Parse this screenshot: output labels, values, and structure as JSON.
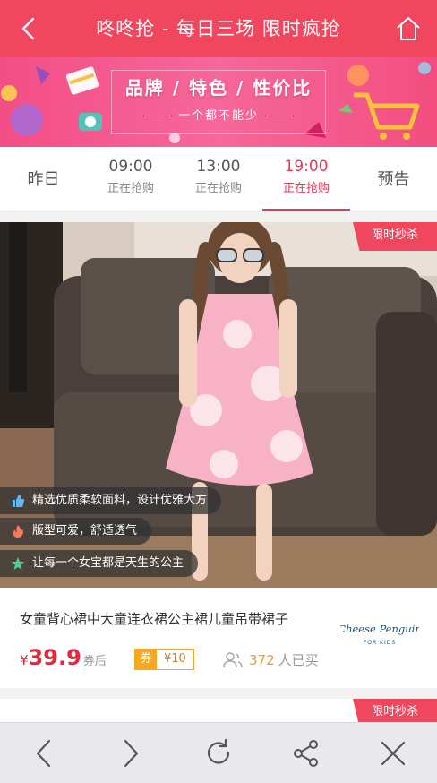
{
  "header": {
    "title": "咚咚抢 - 每日三场 限时疯抢"
  },
  "banner": {
    "headline": "品牌 / 特色 / 性价比",
    "subline": "一个都不能少"
  },
  "tabs": [
    {
      "time": "昨日",
      "status": ""
    },
    {
      "time": "09:00",
      "status": "正在抢购"
    },
    {
      "time": "13:00",
      "status": "正在抢购"
    },
    {
      "time": "19:00",
      "status": "正在抢购"
    },
    {
      "time": "预告",
      "status": ""
    }
  ],
  "active_tab": "19:00",
  "product": {
    "badge": "限时秒杀",
    "features": [
      {
        "icon": "thumbs-up-icon",
        "text": "精选优质柔软面料，设计优雅大方"
      },
      {
        "icon": "flame-icon",
        "text": "版型可爱，舒适透气"
      },
      {
        "icon": "star-icon",
        "text": "让每一个女宝都是天生的公主"
      }
    ],
    "name": "女童背心裙中大童连衣裙公主裙儿童吊带裙子",
    "currency": "¥",
    "price": "39.9",
    "price_suffix": "券后",
    "coupon_label": "券",
    "coupon_value": "¥10",
    "sold_count": "372",
    "sold_suffix": "人已买",
    "brand_logo": {
      "line1": "Cheese Penguin",
      "line2": "FOR KIDS"
    }
  },
  "next_product": {
    "badge": "限时秒杀"
  },
  "colors": {
    "primary": "#f0465e",
    "price": "#e8263d",
    "coupon": "#f5a623"
  }
}
